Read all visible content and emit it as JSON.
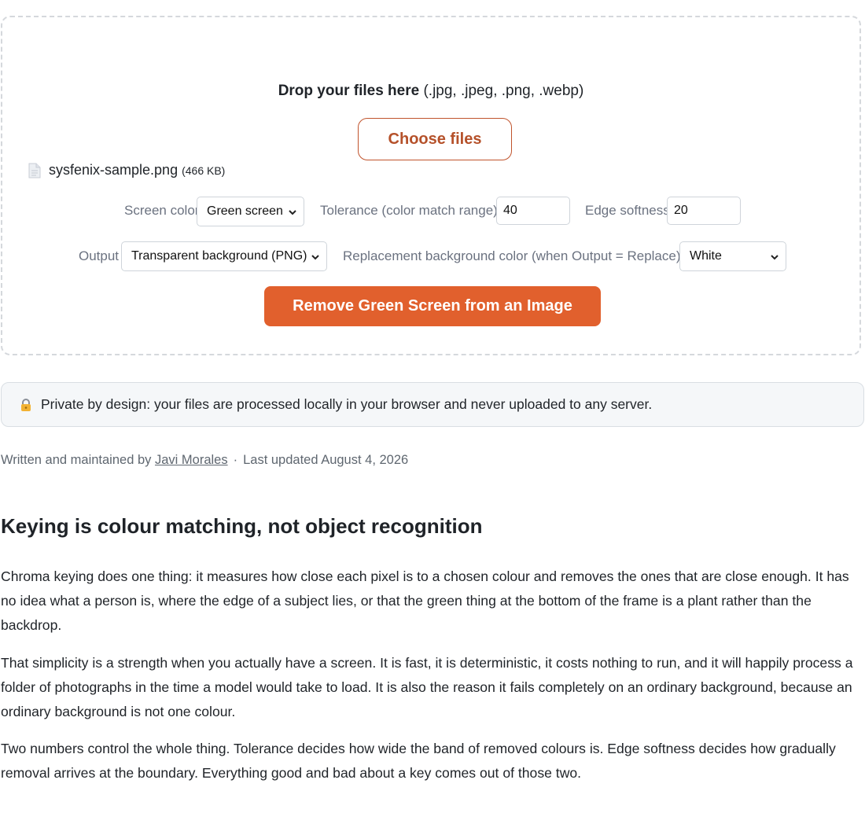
{
  "dropzone": {
    "title_bold": "Drop your files here",
    "title_ext": "(.jpg, .jpeg, .png, .webp)",
    "choose_label": "Choose files"
  },
  "file": {
    "name": "sysfenix-sample.png",
    "size": "(466 KB)",
    "icon": "file-icon"
  },
  "options": {
    "screen_color_label": "Screen color",
    "screen_color_value": "Green screen",
    "tolerance_label": "Tolerance (color match range)",
    "tolerance_value": "40",
    "edge_label": "Edge softness",
    "edge_value": "20",
    "output_label": "Output",
    "output_value": "Transparent background (PNG)",
    "replacement_label": "Replacement background color (when Output = Replace)",
    "replacement_value": "White"
  },
  "action": {
    "label": "Remove Green Screen from an Image"
  },
  "privacy": {
    "icon": "lock-icon",
    "text": "Private by design: your files are processed locally in your browser and never uploaded to any server."
  },
  "byline": {
    "prefix": "Written and maintained by",
    "author": "Javi Morales",
    "separator": "·",
    "updated": "Last updated August 4, 2026"
  },
  "article": {
    "heading": "Keying is colour matching, not object recognition",
    "paragraphs": [
      "Chroma keying does one thing: it measures how close each pixel is to a chosen colour and removes the ones that are close enough. It has no idea what a person is, where the edge of a subject lies, or that the green thing at the bottom of the frame is a plant rather than the backdrop.",
      "That simplicity is a strength when you actually have a screen. It is fast, it is deterministic, it costs nothing to run, and it will happily process a folder of photographs in the time a model would take to load. It is also the reason it fails completely on an ordinary background, because an ordinary background is not one colour.",
      "Two numbers control the whole thing. Tolerance decides how wide the band of removed colours is. Edge softness decides how gradually removal arrives at the boundary. Everything good and bad about a key comes out of those two."
    ]
  },
  "colors": {
    "accent": "#e1602d",
    "accent_text": "#b5512a",
    "dropzone_border": "#d5d8dc"
  }
}
